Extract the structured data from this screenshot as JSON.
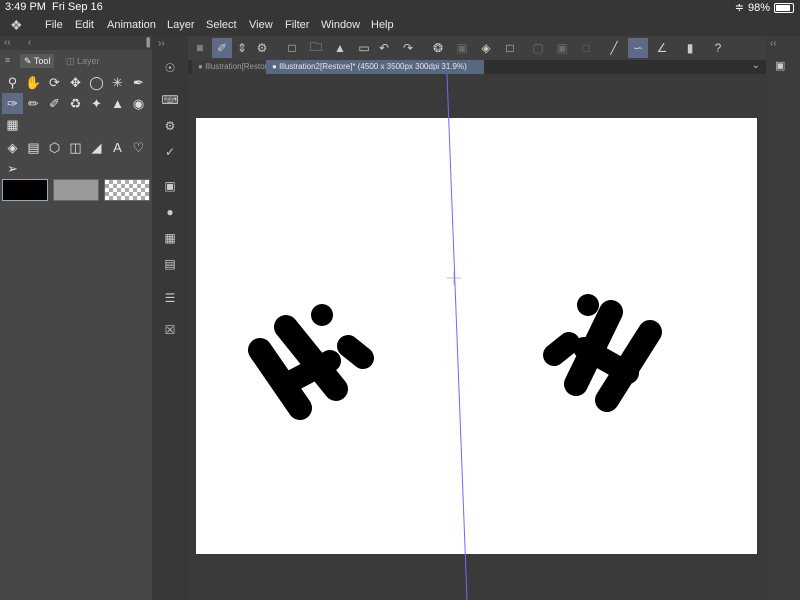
{
  "status": {
    "time": "3:49 PM",
    "date": "Fri Sep 16",
    "battery": "98%"
  },
  "menu": {
    "items": [
      "File",
      "Edit",
      "Animation",
      "Layer",
      "Select",
      "View",
      "Filter",
      "Window",
      "Help"
    ]
  },
  "panel": {
    "tabs": {
      "tool": "Tool",
      "layer": "Layer"
    }
  },
  "document_tabs": [
    {
      "label": "Illustration[Restore]",
      "active": false
    },
    {
      "label": "Illustration2[Restore]* (4500 x 3500px 300dpi 31.9%)",
      "active": true
    }
  ],
  "colors": {
    "main": "#000000",
    "sub": "#9a9a9a",
    "accent": "#5f6b86",
    "guide": "#6b6bff"
  },
  "icons": {
    "tools": [
      "zoom-icon",
      "hand-icon",
      "rotate-icon",
      "move-icon",
      "lasso-icon",
      "magic-wand-icon",
      "eyedropper-icon",
      "pen-icon",
      "pencil-icon",
      "brush-icon",
      "airbrush-icon",
      "decoration-icon",
      "eraser-icon",
      "blend-icon",
      "grid-icon",
      "fill-icon",
      "gradient-icon",
      "figure-icon",
      "frame-icon",
      "ruler-icon",
      "text-icon",
      "balloon-icon",
      "operation-icon"
    ],
    "toolbar": [
      "menu-icon",
      "edit-icon",
      "chevrons-icon",
      "swirl-icon",
      "new-icon",
      "open-icon",
      "save-icon",
      "export-icon",
      "undo-icon",
      "redo-icon",
      "loading-icon",
      "transform-icon",
      "fill-bucket-icon",
      "crop-icon",
      "clear-icon",
      "invert-icon",
      "border-icon",
      "snap-line-icon",
      "snap-curve-icon",
      "snap-angle-icon",
      "phone-icon",
      "help-icon"
    ]
  }
}
